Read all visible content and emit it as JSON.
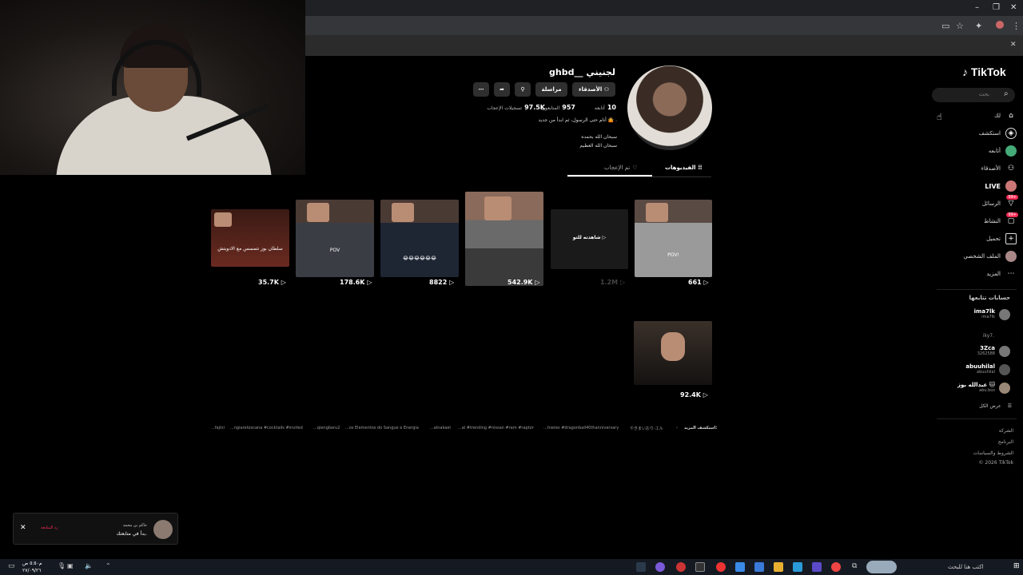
{
  "browser": {
    "window_controls": {
      "minimize": "–",
      "maximize": "❐",
      "close": "✕"
    },
    "close_bar": "✕"
  },
  "sidebar": {
    "logo": "TikTok",
    "search_placeholder": "بحث",
    "nav": [
      {
        "label": "لك",
        "icon": "home-icon"
      },
      {
        "label": "استكشف",
        "icon": "compass-icon"
      },
      {
        "label": "أتابعه",
        "icon": "following-icon"
      },
      {
        "label": "الأصدقاء",
        "icon": "friends-icon"
      },
      {
        "label": "LIVE",
        "icon": "live-icon"
      },
      {
        "label": "الرسائل",
        "icon": "messages-icon",
        "badge": "99+"
      },
      {
        "label": "النشاط",
        "icon": "activity-icon",
        "badge": "99+"
      },
      {
        "label": "تحميل",
        "icon": "upload-icon"
      },
      {
        "label": "الملف الشخصي",
        "icon": "profile-icon"
      },
      {
        "label": "المزيد",
        "icon": "more-icon"
      }
    ],
    "following_title": "حسابات تتابعها",
    "accounts": [
      {
        "name": "ima7lk",
        "handle": "ima7lk"
      },
      {
        "name": "",
        "handle": "iky7."
      },
      {
        "name": "3Zca",
        "handle": "3262588"
      },
      {
        "name": "abuuhilal",
        "handle": "abuuhilal"
      },
      {
        "name": "عبدالله بوز 🐱",
        "handle": "abu.boz"
      }
    ],
    "see_all": "عرض الكل",
    "footer": [
      "الشركة",
      "البرنامج",
      "الشروط والسياسات",
      "© 2026 TikTok"
    ]
  },
  "profile": {
    "username": "ghbd__ لجنيني",
    "buttons": {
      "friends": "الأصدقاء",
      "message": "مراسلة"
    },
    "stats": [
      {
        "num": "10",
        "label": "أتابعه"
      },
      {
        "num": "957",
        "label": "المتابعون"
      },
      {
        "num": "97.5K",
        "label": "تسجيلات الإعجاب"
      }
    ],
    "bio_line1": "أنام حتى الرسول، ثم ابدأ من جديد 🤷 .",
    "bio_line2": "سبحان الله بحمده",
    "bio_line3": "سبحان الله العظيم",
    "tabs": {
      "videos": "الفيديوهات",
      "liked": "تم الإعجاب"
    }
  },
  "videos": [
    {
      "views": "661",
      "caption": "POV!"
    },
    {
      "views": "1.2M",
      "caption": "شاهدته للتو",
      "watched": true
    },
    {
      "views": "542.9K",
      "caption": ""
    },
    {
      "views": "8822",
      "caption": "😂😂😂😂😂😂"
    },
    {
      "views": "178.6K",
      "caption": "POV"
    },
    {
      "views": "35.7K",
      "caption": "سلطان بوز تتمسس مع الادويتش"
    },
    {
      "views": "92.4K",
      "caption": ""
    }
  ],
  "explore": {
    "label": "استكشف المزيد:",
    "items": [
      "やきまいおり-エル",
      "...tneres #dragonball40thanniversary",
      "...al #trending #nissan #ram #raptor",
      "...alnakael",
      "...os Elementos do Sangue e Energia",
      "...qiengbaru2",
      "...ngiaretoscana #cocktails #invited",
      "...fajini"
    ]
  },
  "notification": {
    "name": "حاكم بن محمد",
    "text": "بدأ في متابعتك.",
    "action": "رد المتابعة",
    "close": "✕"
  },
  "taskbar": {
    "search_placeholder": "اكتب هنا للبحث",
    "time": "م٥:٥٠ ص",
    "date": "٢٧/٠٩/٢٦"
  }
}
